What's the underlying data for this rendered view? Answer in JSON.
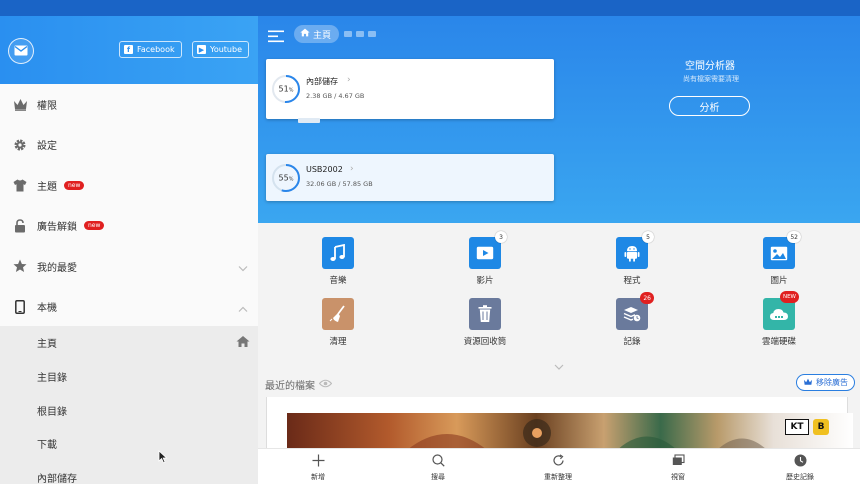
{
  "drawer": {
    "facebook_label": "Facebook",
    "youtube_label": "Youtube",
    "items": [
      {
        "label": "權限",
        "icon": "crown-icon"
      },
      {
        "label": "設定",
        "icon": "gear-icon"
      },
      {
        "label": "主題",
        "icon": "shirt-icon",
        "badge": "new"
      },
      {
        "label": "廣告解鎖",
        "icon": "lock-icon",
        "badge": "new"
      },
      {
        "label": "我的最愛",
        "icon": "star-icon"
      },
      {
        "label": "本機",
        "icon": "phone-icon"
      }
    ],
    "sub_items": [
      "主頁",
      "主目錄",
      "根目錄",
      "下載",
      "內部儲存"
    ]
  },
  "header": {
    "breadcrumb_home": "主頁"
  },
  "storage": {
    "internal": {
      "name": "內部儲存",
      "percent": "51",
      "percent_unit": "%",
      "usage": "2.38 GB / 4.67 GB",
      "fill": 0.51
    },
    "usb": {
      "name": "USB2002",
      "percent": "55",
      "percent_unit": "%",
      "usage": "32.06 GB / 57.85 GB",
      "fill": 0.55
    }
  },
  "analyzer": {
    "title": "空間分析器",
    "subtitle": "尚有檔案需要清理",
    "button": "分析"
  },
  "categories": [
    {
      "label": "音樂",
      "icon": "music-icon",
      "color": "#1e88e5"
    },
    {
      "label": "影片",
      "icon": "video-icon",
      "color": "#1e88e5",
      "badge": "3"
    },
    {
      "label": "程式",
      "icon": "android-icon",
      "color": "#1e88e5",
      "badge": "5"
    },
    {
      "label": "圖片",
      "icon": "image-icon",
      "color": "#1e88e5",
      "badge": "52"
    },
    {
      "label": "清理",
      "icon": "broom-icon",
      "color": "#c9926a"
    },
    {
      "label": "資源回收筒",
      "icon": "trash-icon",
      "color": "#6a7a9c"
    },
    {
      "label": "記錄",
      "icon": "log-icon",
      "color": "#6a7a9c",
      "badge": "26"
    },
    {
      "label": "雲端硬碟",
      "icon": "cloud-icon",
      "color": "#33b5a8",
      "badge": "NEW"
    }
  ],
  "recent": {
    "label": "最近的檔案",
    "remove_ads": "移除廣告"
  },
  "ad": {
    "logo1": "KT",
    "logo2": "B"
  },
  "bottom_bar": [
    {
      "label": "新增",
      "icon": "plus-icon"
    },
    {
      "label": "搜尋",
      "icon": "search-icon"
    },
    {
      "label": "重新整理",
      "icon": "refresh-icon"
    },
    {
      "label": "視窗",
      "icon": "windows-icon"
    },
    {
      "label": "歷史記錄",
      "icon": "clock-icon"
    }
  ]
}
